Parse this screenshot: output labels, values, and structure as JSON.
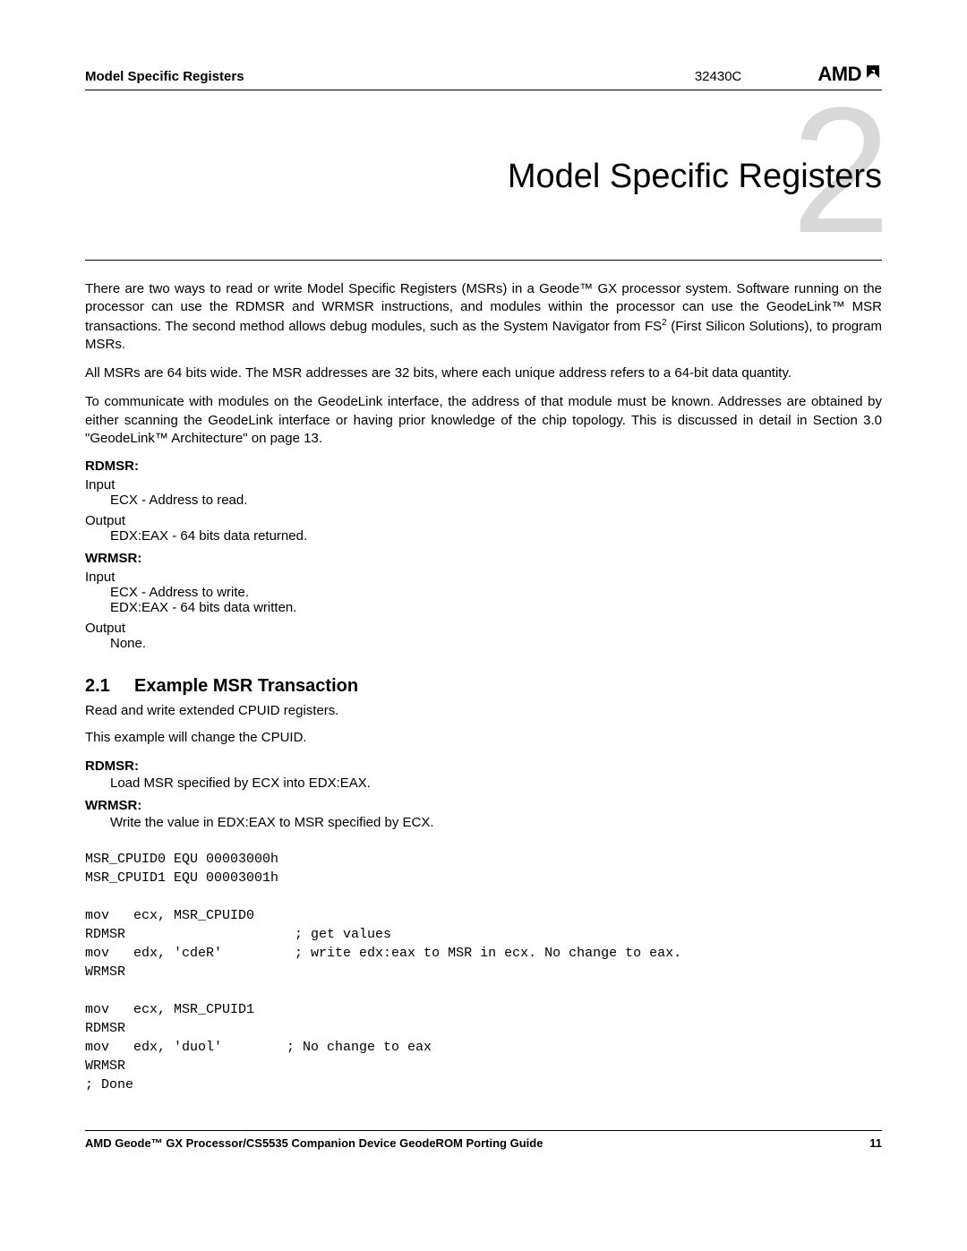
{
  "header": {
    "section": "Model Specific Registers",
    "docnum": "32430C",
    "logo_text": "AMD"
  },
  "chapter": {
    "number": "2",
    "title": "Model Specific Registers"
  },
  "paragraphs": {
    "p1a": "There are two ways to read or write Model Specific Registers (MSRs) in a Geode™ GX processor system. Software running on the processor can use the RDMSR and WRMSR instructions, and modules within the processor can use the GeodeLink™ MSR transactions. The second method allows debug modules, such as the System Navigator from FS",
    "p1_sup": "2",
    "p1b": " (First Silicon Solutions), to program MSRs.",
    "p2": "All MSRs are 64 bits wide. The MSR addresses are 32 bits, where each unique address refers to a 64-bit data quantity.",
    "p3": "To communicate with modules on the GeodeLink interface, the address of that module must be known. Addresses are obtained by either scanning the GeodeLink interface or having prior knowledge of the chip topology. This is discussed in detail in Section 3.0 \"GeodeLink™ Architecture\" on page 13."
  },
  "rdmsr": {
    "label": "RDMSR:",
    "input_label": "Input",
    "input_text": "ECX - Address to read.",
    "output_label": "Output",
    "output_text": "EDX:EAX - 64 bits data returned."
  },
  "wrmsr": {
    "label": "WRMSR:",
    "input_label": "Input",
    "input_text1": "ECX - Address to write.",
    "input_text2": "EDX:EAX - 64 bits data written.",
    "output_label": "Output",
    "output_text": "None."
  },
  "section21": {
    "num": "2.1",
    "title": "Example MSR Transaction",
    "p1": "Read and write extended CPUID registers.",
    "p2": "This example will change the CPUID.",
    "rdmsr_label": "RDMSR:",
    "rdmsr_text": "Load MSR specified by ECX into EDX:EAX.",
    "wrmsr_label": "WRMSR:",
    "wrmsr_text": "Write the value in EDX:EAX to MSR specified by ECX."
  },
  "code": "MSR_CPUID0 EQU 00003000h\nMSR_CPUID1 EQU 00003001h\n\nmov   ecx, MSR_CPUID0\nRDMSR                     ; get values\nmov   edx, 'cdeR'         ; write edx:eax to MSR in ecx. No change to eax.\nWRMSR\n\nmov   ecx, MSR_CPUID1\nRDMSR\nmov   edx, 'duol'        ; No change to eax\nWRMSR\n; Done",
  "footer": {
    "text": "AMD Geode™ GX Processor/CS5535 Companion Device GeodeROM Porting Guide",
    "page": "11"
  }
}
